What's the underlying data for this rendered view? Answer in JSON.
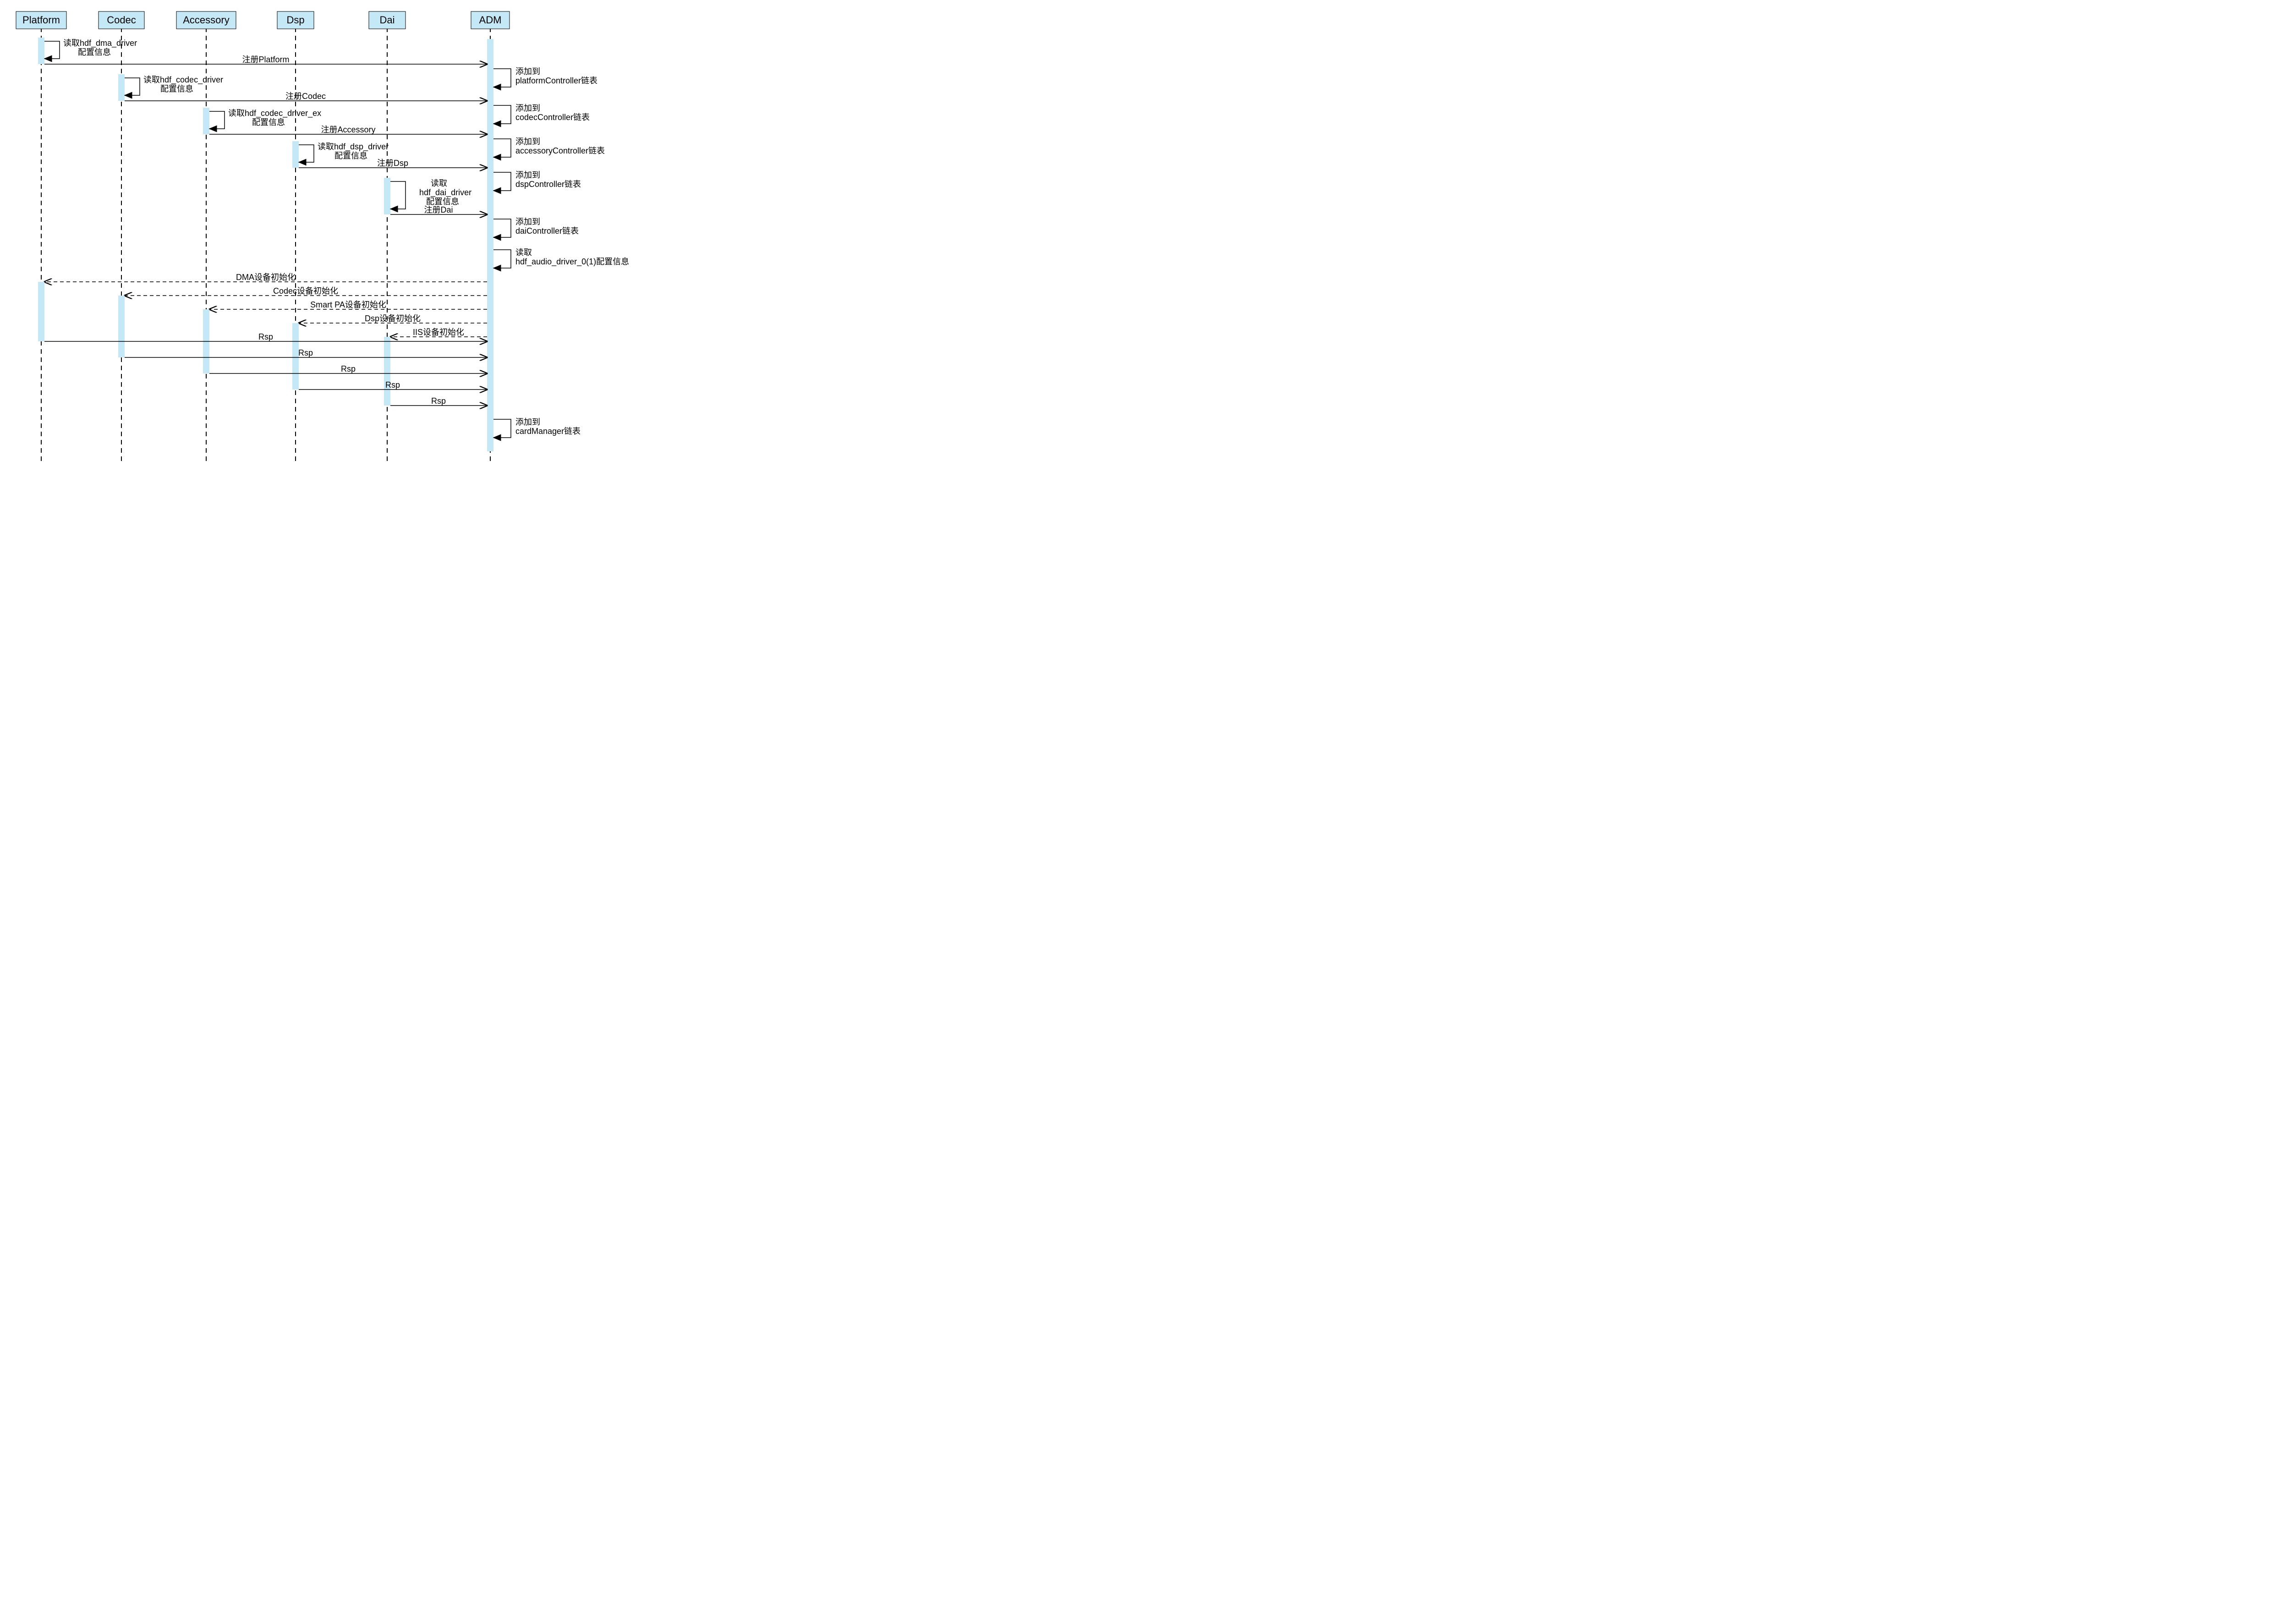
{
  "participants": {
    "platform": "Platform",
    "codec": "Codec",
    "accessory": "Accessory",
    "dsp": "Dsp",
    "dai": "Dai",
    "adm": "ADM"
  },
  "self_messages": {
    "platform_read_l1": "读取hdf_dma_driver",
    "platform_read_l2": "配置信息",
    "codec_read_l1": "读取hdf_codec_driver",
    "codec_read_l2": "配置信息",
    "accessory_read_l1": "读取hdf_codec_driver_ex",
    "accessory_read_l2": "配置信息",
    "dsp_read_l1": "读取hdf_dsp_driver",
    "dsp_read_l2": "配置信息",
    "dai_read_l1": "读取",
    "dai_read_l2": "hdf_dai_driver",
    "dai_read_l3": "配置信息",
    "adm_add_platform_l1": "添加到",
    "adm_add_platform_l2": "platformController链表",
    "adm_add_codec_l1": "添加到",
    "adm_add_codec_l2": "codecController链表",
    "adm_add_accessory_l1": "添加到",
    "adm_add_accessory_l2": "accessoryController链表",
    "adm_add_dsp_l1": "添加到",
    "adm_add_dsp_l2": "dspController链表",
    "adm_add_dai_l1": "添加到",
    "adm_add_dai_l2": "daiController链表",
    "adm_read_audio_l1": "读取",
    "adm_read_audio_l2": "hdf_audio_driver_0(1)配置信息",
    "adm_card_l1": "添加到",
    "adm_card_l2": "cardManager链表"
  },
  "messages": {
    "reg_platform": "注册Platform",
    "reg_codec": "注册Codec",
    "reg_accessory": "注册Accessory",
    "reg_dsp": "注册Dsp",
    "reg_dai": "注册Dai",
    "init_dma": "DMA设备初始化",
    "init_codec": "Codec设备初始化",
    "init_smartpa": "Smart PA设备初始化",
    "init_dsp": "Dsp设备初始化",
    "init_iis": "IIS设备初始化",
    "rsp": "Rsp"
  }
}
